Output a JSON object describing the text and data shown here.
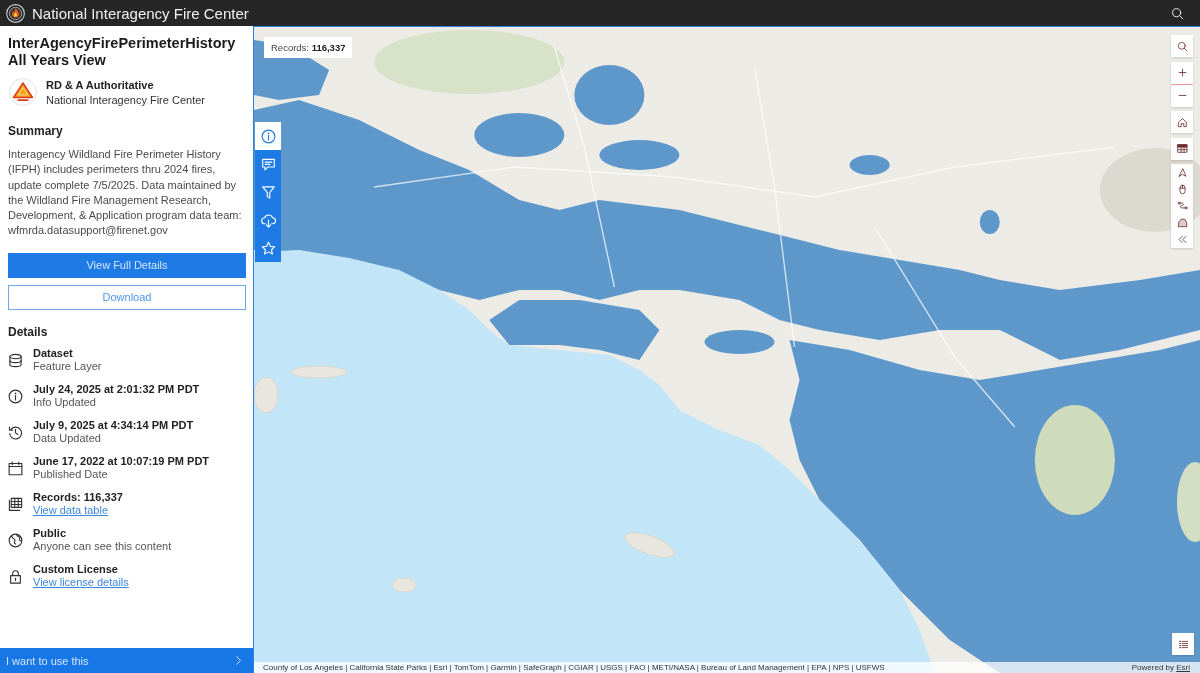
{
  "header": {
    "title": "National Interagency Fire Center"
  },
  "item": {
    "title": "InterAgencyFirePerimeterHistory All Years View",
    "owner": "RD & A Authoritative",
    "organization": "National Interagency Fire Center"
  },
  "summary": {
    "heading": "Summary",
    "text": "Interagency Wildland Fire Perimeter History (IFPH) includes perimeters thru 2024 fires, update complete 7/5/2025. Data maintained by the Wildland Fire Management Research, Development, & Application program data team: wfmrda.datasupport@firenet.gov"
  },
  "actions": [
    {
      "kind": "primary",
      "label": "View Full Details"
    },
    {
      "kind": "outline",
      "label": "Download"
    }
  ],
  "details": {
    "heading": "Details",
    "items": [
      {
        "kind": "type",
        "title": "Dataset",
        "subtitle": "Feature Layer"
      },
      {
        "kind": "info",
        "title": "July 24, 2025 at 2:01:32 PM PDT",
        "subtitle": "Info Updated"
      },
      {
        "kind": "history",
        "title": "July 9, 2025 at 4:34:14 PM PDT",
        "subtitle": "Data Updated"
      },
      {
        "kind": "calendar",
        "title": "June 17, 2022 at 10:07:19 PM PDT",
        "subtitle": "Published Date"
      },
      {
        "kind": "records",
        "title": "Records: 116,337",
        "link": "View data table"
      },
      {
        "kind": "access",
        "title": "Public",
        "subtitle": "Anyone can see this content"
      },
      {
        "kind": "license",
        "title": "Custom License",
        "link": "View license details"
      }
    ]
  },
  "use_bar": {
    "label": "I want to use this"
  },
  "side_tabs": [
    {
      "kind": "about",
      "selected": true
    },
    {
      "kind": "comments",
      "selected": false
    },
    {
      "kind": "filter",
      "selected": false
    },
    {
      "kind": "download",
      "selected": false
    },
    {
      "kind": "favorite",
      "selected": false
    }
  ],
  "map": {
    "records": "Records: **116,337**",
    "attribution": "County of Los Angeles | California State Parks | Esri | TomTom | Garmin | SafeGraph | CGIAR | USGS | FAO | METI/NASA | Bureau of Land Management | EPA | NPS | USFWS",
    "powered_by": "Powered by",
    "powered_by_link": "Esri"
  }
}
